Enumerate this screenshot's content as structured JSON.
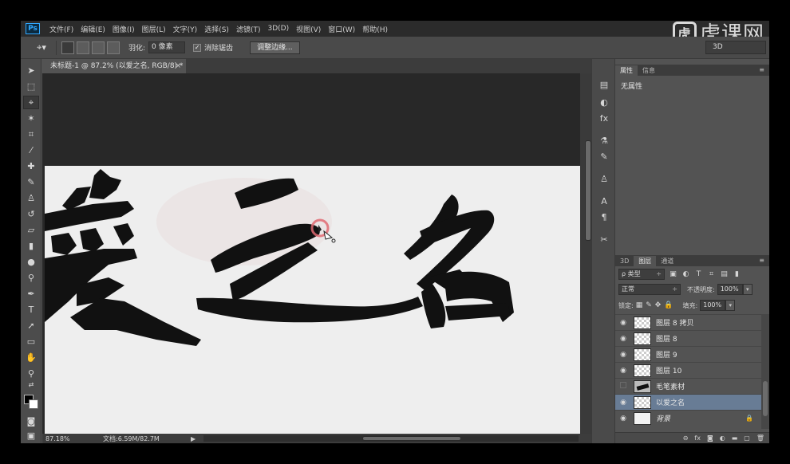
{
  "app": {
    "logo": "Ps",
    "menu": [
      "文件(F)",
      "编辑(E)",
      "图像(I)",
      "图层(L)",
      "文字(Y)",
      "选择(S)",
      "滤镜(T)",
      "3D(D)",
      "视图(V)",
      "窗口(W)",
      "帮助(H)"
    ],
    "watermark": "虎课网",
    "watermark_icon": "虎"
  },
  "options": {
    "feather_label": "羽化:",
    "feather_value": "0 像素",
    "antialias_label": "消除锯齿",
    "antialias_checked": true,
    "refine_edge_label": "调整边缘...",
    "workspace": "3D"
  },
  "document": {
    "tab_title": "未标题-1 @ 87.2% (以爱之名, RGB/8) *",
    "close_icon": "×",
    "canvas_text": "爱之名"
  },
  "status": {
    "zoom": "87.18%",
    "doc_info": "文档:6.59M/82.7M"
  },
  "properties": {
    "tabs": [
      "属性",
      "信息"
    ],
    "active_tab": 0,
    "content": "无属性"
  },
  "layers_panel": {
    "tabs": [
      "3D",
      "图层",
      "通道"
    ],
    "active_tab": 1,
    "filter_kind": "ρ 类型",
    "blend_mode": "正常",
    "opacity_label": "不透明度:",
    "opacity_value": "100%",
    "lock_label": "锁定:",
    "fill_label": "填充:",
    "fill_value": "100%",
    "layers": [
      {
        "name": "图层 8 拷贝",
        "visible": true,
        "thumb": "transparent",
        "selected": false
      },
      {
        "name": "图层 8",
        "visible": true,
        "thumb": "transparent",
        "selected": false
      },
      {
        "name": "图层 9",
        "visible": true,
        "thumb": "transparent",
        "selected": false
      },
      {
        "name": "图层 10",
        "visible": true,
        "thumb": "transparent",
        "selected": false
      },
      {
        "name": "毛笔素材",
        "visible": false,
        "thumb": "brush",
        "selected": false
      },
      {
        "name": "以爱之名",
        "visible": true,
        "thumb": "transparent",
        "selected": true
      },
      {
        "name": "背景",
        "visible": true,
        "thumb": "white",
        "selected": false,
        "locked": true
      }
    ]
  }
}
